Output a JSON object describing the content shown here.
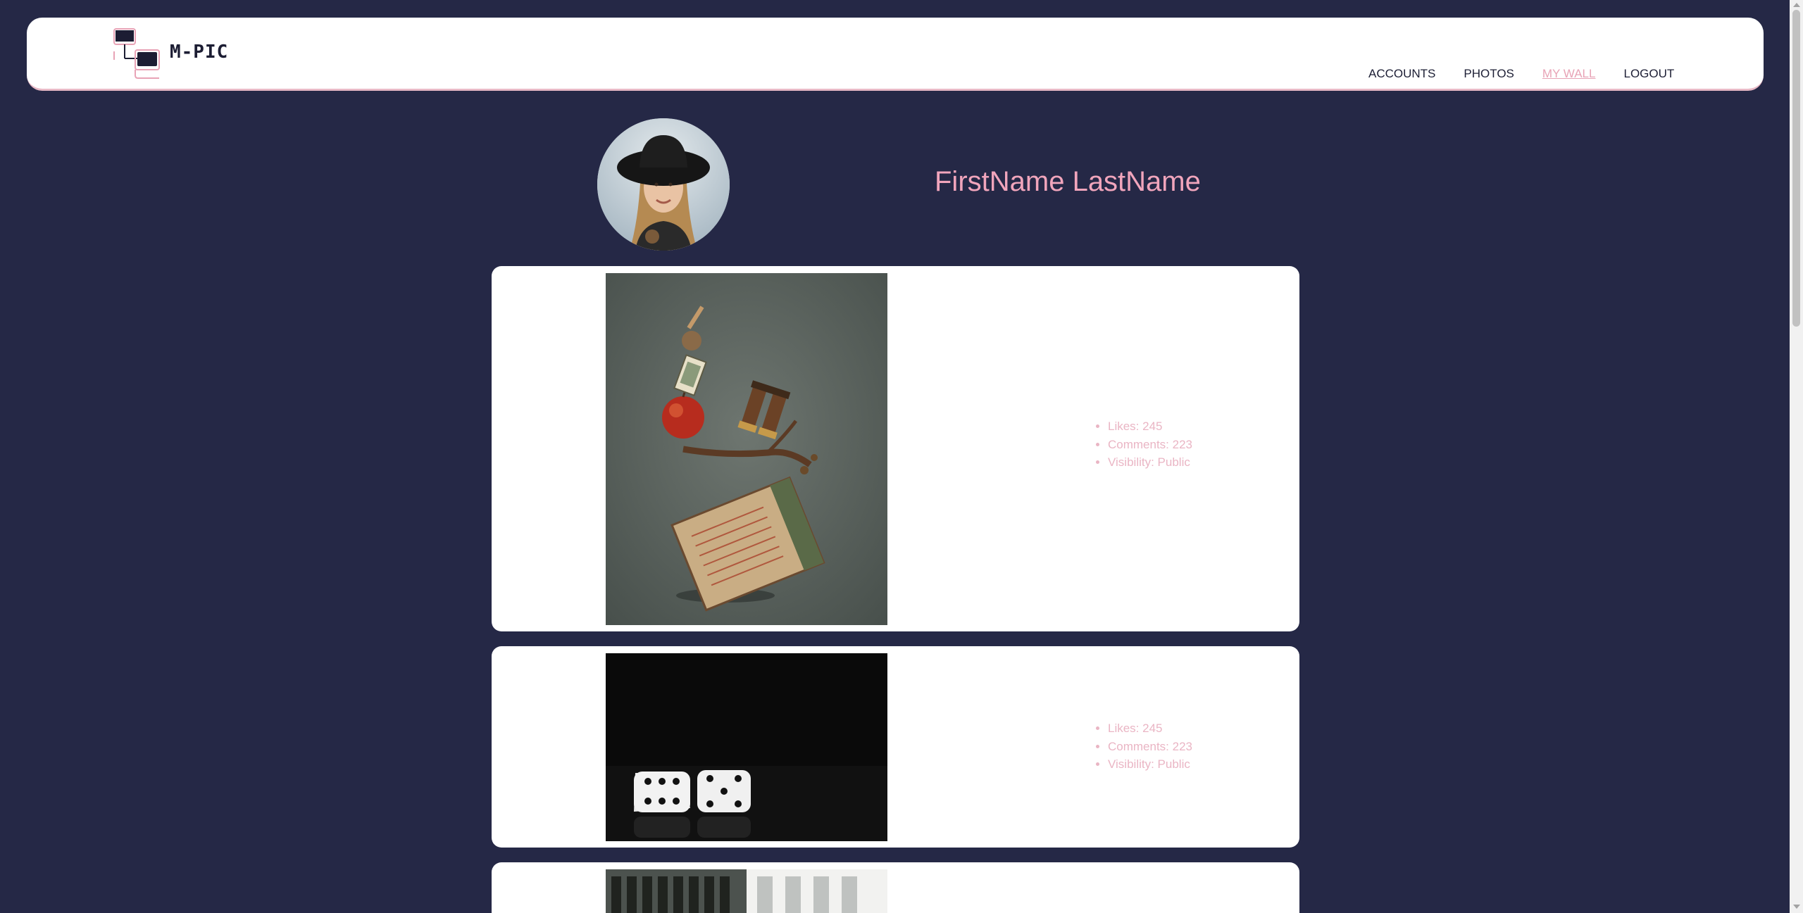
{
  "brand": {
    "name": "M-PIC",
    "logo_icon": "monitors-logo-icon",
    "colors": {
      "background": "#252846",
      "accent": "#f1a5bc",
      "header": "#ffffff"
    }
  },
  "nav": {
    "items": [
      {
        "label": "ACCOUNTS",
        "active": false
      },
      {
        "label": "PHOTOS",
        "active": false
      },
      {
        "label": "MY WALL",
        "active": true
      },
      {
        "label": "LOGOUT",
        "active": false
      }
    ]
  },
  "profile": {
    "name": "FirstName LastName",
    "avatar_icon": "profile-photo"
  },
  "posts": [
    {
      "image": "balanced-objects-photo",
      "likes": "Likes: 245",
      "comments": "Comments: 223",
      "visibility": "Visibility: Public"
    },
    {
      "image": "dice-photo",
      "likes": "Likes: 245",
      "comments": "Comments: 223",
      "visibility": "Visibility: Public"
    },
    {
      "image": "building-photo"
    }
  ]
}
